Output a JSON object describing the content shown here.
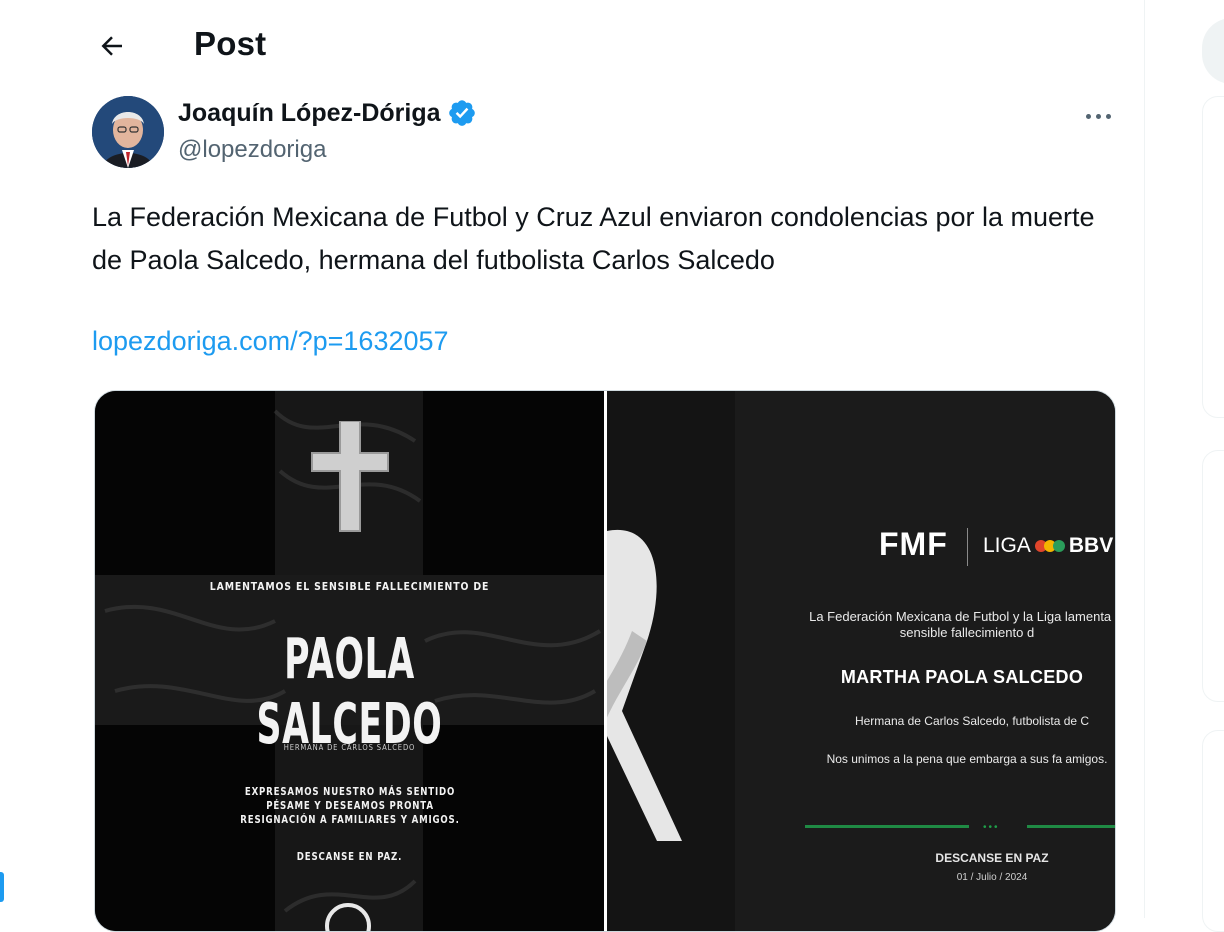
{
  "header": {
    "title": "Post",
    "back_label": "←"
  },
  "author": {
    "name": "Joaquín López-Dóriga",
    "handle": "@lopezdoriga",
    "verified": true
  },
  "tweet": {
    "text": "La Federación Mexicana de Futbol y Cruz Azul enviaron condolencias por la muerte de Paola Salcedo, hermana del futbolista Carlos Salcedo",
    "link": "lopezdoriga.com/?p=1632057"
  },
  "media": {
    "left_image": {
      "kicker": "LAMENTAMOS EL SENSIBLE FALLECIMIENTO DE",
      "name": "PAOLA SALCEDO",
      "subtitle": "HERMANA DE CARLOS SALCEDO",
      "message": "EXPRESAMOS NUESTRO MÁS SENTIDO PÉSAME Y DESEAMOS PRONTA RESIGNACIÓN A FAMILIARES Y AMIGOS.",
      "rip": "DESCANSE EN PAZ."
    },
    "right_image": {
      "fmf": "FMF",
      "liga": "LIGA",
      "liga_suffix": "BBV",
      "line1": "La Federación Mexicana de Futbol y la Liga lamenta el sensible fallecimiento d",
      "name": "MARTHA PAOLA SALCEDO",
      "line3": "Hermana de Carlos Salcedo, futbolista de C",
      "line4": "Nos unimos a la pena que embarga a sus fa amigos.",
      "rip": "DESCANSE EN PAZ",
      "date": "01 / Julio / 2024"
    }
  },
  "colors": {
    "accent": "#1d9bf0",
    "secondary_text": "#536471",
    "fmf_green": "#1f8a44"
  },
  "icons": [
    "back-arrow-icon",
    "verified-badge-icon",
    "more-options-icon",
    "cross-icon",
    "ribbon-icon"
  ]
}
